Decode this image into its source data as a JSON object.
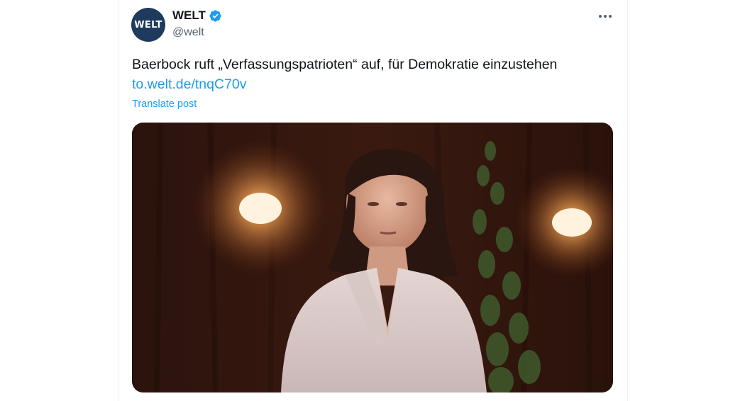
{
  "post": {
    "avatar_text": "WELT",
    "display_name": "WELT",
    "handle": "@welt",
    "text": "Baerbock ruft „Verfassungspatrioten“ auf, für Demokratie einzustehen",
    "link_text": "to.welt.de/tnqC70v",
    "translate_label": "Translate post",
    "verified_icon": "verified-badge-icon",
    "more_icon": "more-dots-icon",
    "media_icon": "photo-image"
  },
  "colors": {
    "text": "#0f1419",
    "secondary": "#536471",
    "accent": "#1d9bf0",
    "avatar_bg": "#1e3a5c"
  }
}
